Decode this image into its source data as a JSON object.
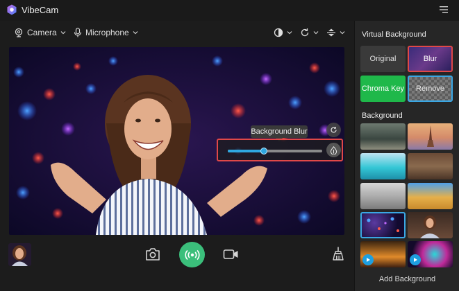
{
  "app": {
    "title": "VibeCam",
    "logo_icon": "vibecam-logo-icon",
    "menu_icon": "hamburger-menu-icon"
  },
  "toolbar": {
    "camera_label": "Camera",
    "microphone_label": "Microphone",
    "icons": [
      "camera-icon",
      "microphone-icon",
      "contrast-icon",
      "refresh-icon",
      "flip-icon",
      "chevron-down-icon"
    ]
  },
  "preview": {
    "blur_tooltip": "Background Blur",
    "blur_level": 0.38,
    "accent_color": "#2fa8e0",
    "highlight_color": "#e04848"
  },
  "bottom": {
    "capture_icon": "camera-icon",
    "live_icon": "broadcast-icon",
    "live_color": "#3bbf7b",
    "record_icon": "video-camera-icon",
    "clean_icon": "broom-icon"
  },
  "sidebar": {
    "virtual_background_title": "Virtual Background",
    "options": [
      {
        "label": "Original"
      },
      {
        "label": "Blur",
        "selected": true
      },
      {
        "label": "Chroma Key"
      },
      {
        "label": "Remove"
      }
    ],
    "background_title": "Background",
    "add_background_label": "Add Background",
    "selected_background": 8
  }
}
